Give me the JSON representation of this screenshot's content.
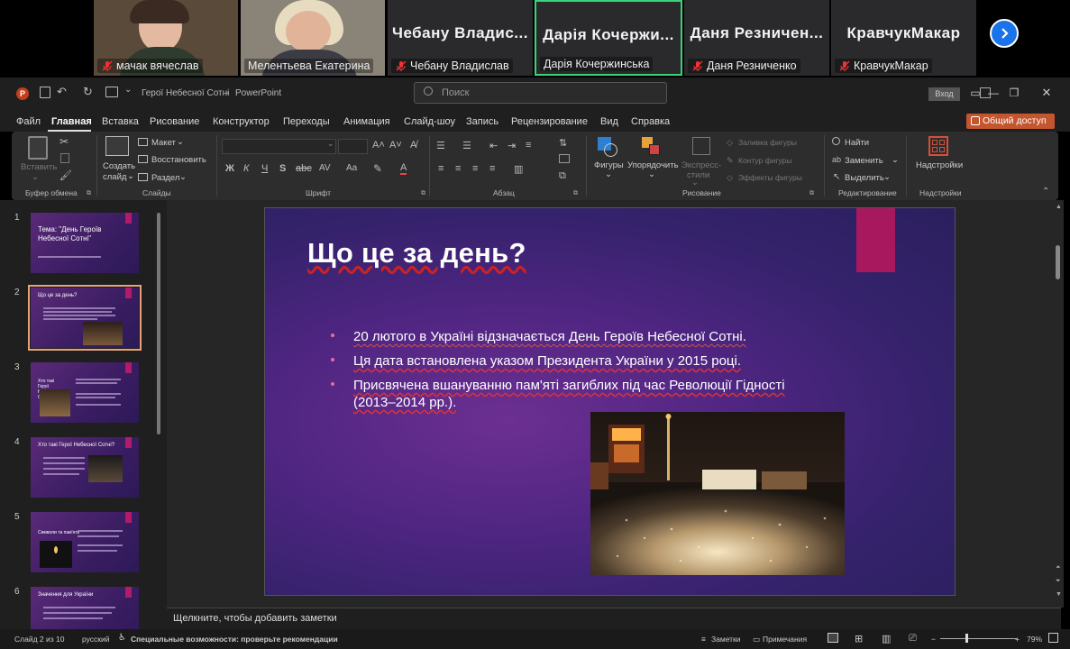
{
  "video": {
    "participants": [
      {
        "caption": "мачак вячеслав",
        "big": ""
      },
      {
        "caption": "Мелентьева Екатерина",
        "big": ""
      },
      {
        "caption": "Чебану Владислав",
        "big": "Чебану Владис..."
      },
      {
        "caption": "Дарія Кочержинська",
        "big": "Дарія Кочержи..."
      },
      {
        "caption": "Даня Резниченко",
        "big": "Даня Резничен..."
      },
      {
        "caption": "КравчукМакар",
        "big": "КравчукМакар"
      }
    ]
  },
  "titlebar": {
    "doc_title": "Герої Небесної Сотні",
    "app": "PowerPoint",
    "search_placeholder": "Поиск",
    "login": "Вход"
  },
  "menu": {
    "items": [
      "Файл",
      "Главная",
      "Вставка",
      "Рисование",
      "Конструктор",
      "Переходы",
      "Анимация",
      "Слайд-шоу",
      "Запись",
      "Рецензирование",
      "Вид",
      "Справка"
    ],
    "share": "Общий доступ"
  },
  "ribbon": {
    "paste": "Вставить",
    "clipboard": "Буфер обмена",
    "new_slide_1": "Создать",
    "new_slide_2": "слайд",
    "layout": "Макет",
    "reset": "Восстановить",
    "section": "Раздел",
    "slides": "Слайды",
    "font_group": "Шрифт",
    "para_group": "Абзац",
    "shapes": "Фигуры",
    "arrange": "Упорядочить",
    "styles_1": "Экспресс-",
    "styles_2": "стили",
    "fill": "Заливка фигуры",
    "outline": "Контур фигуры",
    "effects": "Эффекты фигуры",
    "drawing": "Рисование",
    "find": "Найти",
    "replace": "Заменить",
    "select": "Выделить",
    "editing": "Редактирование",
    "addins": "Надстройки",
    "addins_group": "Надстройки"
  },
  "thumbnails": {
    "nums": [
      "1",
      "2",
      "3",
      "4",
      "5",
      "6"
    ],
    "t1": "Тема: \"День Героїв Небесної Сотні\"",
    "t2": "Що це за день?",
    "t3": "Хто такі Герої Небесної Сотні?",
    "t4": "Значення для України"
  },
  "slide": {
    "title": "Що це за день?",
    "bullets": [
      "20 лютого в Україні відзначається День Героїв Небесної Сотні.",
      "Ця дата встановлена указом Президента України у 2015 році.",
      "Присвячена вшануванню пам'яті загиблих під час Революції Гідності (2013–2014 рр.)."
    ]
  },
  "notes": {
    "placeholder": "Щелкните, чтобы добавить заметки"
  },
  "status": {
    "slide": "Слайд 2 из 10",
    "lang": "русский",
    "access": "Специальные возможности: проверьте рекомендации",
    "notes": "Заметки",
    "comments": "Примечания",
    "zoom": "79%"
  },
  "colors": {
    "accent_pink": "#a8185e",
    "share": "#c4562f",
    "selected_tile": "#3ad37a"
  }
}
